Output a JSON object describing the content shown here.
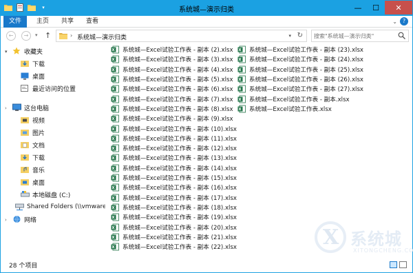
{
  "window": {
    "title": "系统城—演示归类"
  },
  "title_controls": {
    "minimize": "—",
    "maximize": "☐",
    "close": "✕"
  },
  "ribbon": {
    "tabs": [
      "文件",
      "主页",
      "共享",
      "查看"
    ],
    "help": "?"
  },
  "address": {
    "path": "系统城—演示归类",
    "search_placeholder": "搜索\"系统城—演示归类\""
  },
  "nav": {
    "favorites_label": "收藏夹",
    "favorites": [
      "下载",
      "桌面",
      "最近访问的位置"
    ],
    "pc_label": "这台电脑",
    "pc_items": [
      "视频",
      "图片",
      "文档",
      "下载",
      "音乐",
      "桌面",
      "本地磁盘 (C:)",
      "Shared Folders (\\\\vmware-ho"
    ],
    "network_label": "网络"
  },
  "files": [
    "系统城—Excel试验工作表 - 副本 (2).xlsx",
    "系统城—Excel试验工作表 - 副本 (3).xlsx",
    "系统城—Excel试验工作表 - 副本 (4).xlsx",
    "系统城—Excel试验工作表 - 副本 (5).xlsx",
    "系统城—Excel试验工作表 - 副本 (6).xlsx",
    "系统城—Excel试验工作表 - 副本 (7).xlsx",
    "系统城—Excel试验工作表 - 副本 (8).xlsx",
    "系统城—Excel试验工作表 - 副本 (9).xlsx",
    "系统城—Excel试验工作表 - 副本 (10).xlsx",
    "系统城—Excel试验工作表 - 副本 (11).xlsx",
    "系统城—Excel试验工作表 - 副本 (12).xlsx",
    "系统城—Excel试验工作表 - 副本 (13).xlsx",
    "系统城—Excel试验工作表 - 副本 (14).xlsx",
    "系统城—Excel试验工作表 - 副本 (15).xlsx",
    "系统城—Excel试验工作表 - 副本 (16).xlsx",
    "系统城—Excel试验工作表 - 副本 (17).xlsx",
    "系统城—Excel试验工作表 - 副本 (18).xlsx",
    "系统城—Excel试验工作表 - 副本 (19).xlsx",
    "系统城—Excel试验工作表 - 副本 (20).xlsx",
    "系统城—Excel试验工作表 - 副本 (21).xlsx",
    "系统城—Excel试验工作表 - 副本 (22).xlsx",
    "系统城—Excel试验工作表 - 副本 (23).xlsx",
    "系统城—Excel试验工作表 - 副本 (24).xlsx",
    "系统城—Excel试验工作表 - 副本 (25).xlsx",
    "系统城—Excel试验工作表 - 副本 (26).xlsx",
    "系统城—Excel试验工作表 - 副本 (27).xlsx",
    "系统城—Excel试验工作表 - 副本.xlsx",
    "系统城—Excel试验工作表.xlsx"
  ],
  "status": {
    "item_count": "28 个项目"
  },
  "watermark": {
    "brand": "系统城",
    "sub": "XITONGCHENG.COM"
  },
  "colors": {
    "accent": "#1ba1e2",
    "file_tab": "#1979ca",
    "close": "#c7504c",
    "excel": "#1e7145"
  }
}
